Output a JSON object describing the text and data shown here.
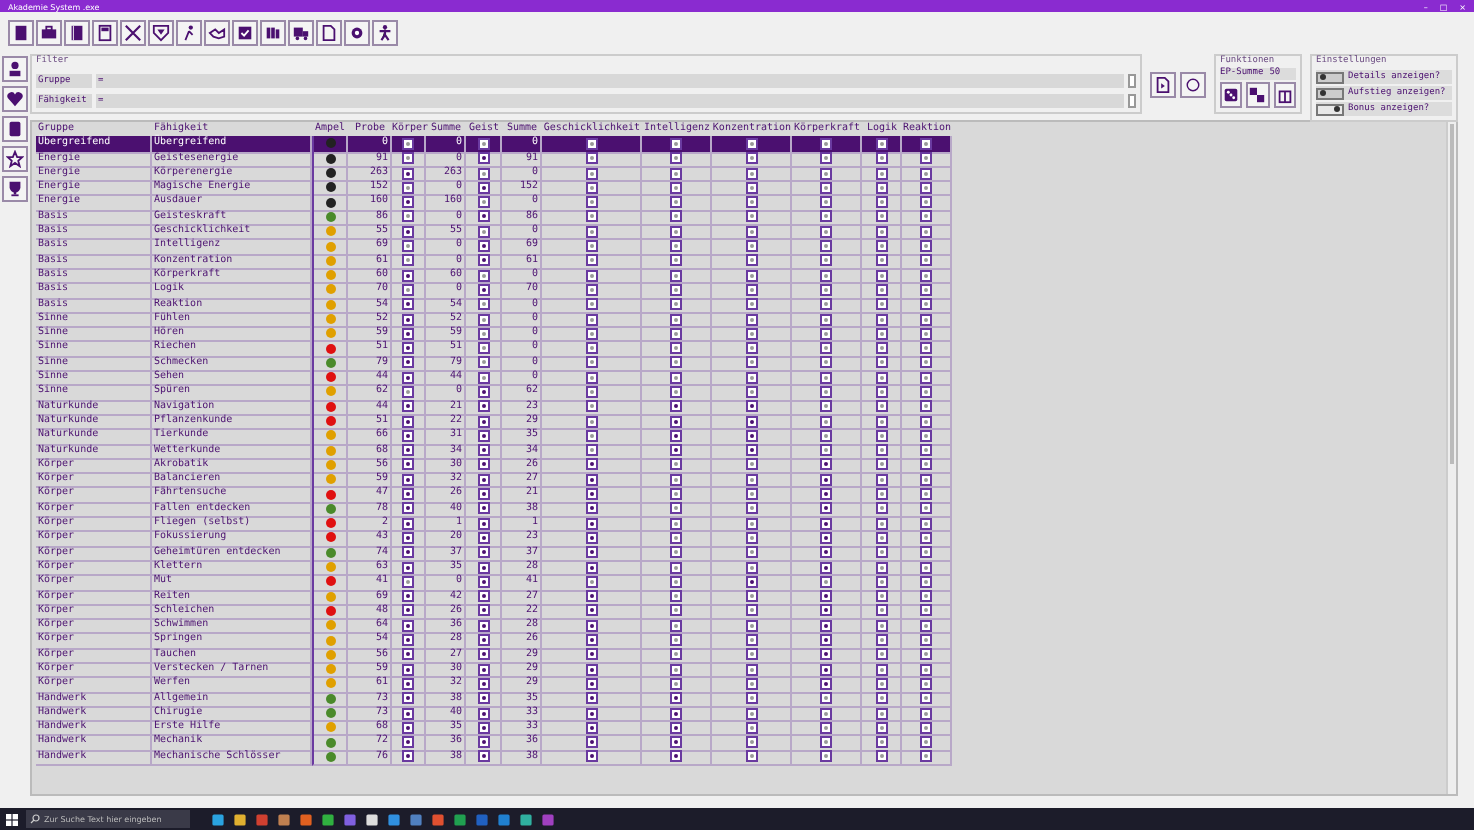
{
  "window": {
    "title": "Akademie System .exe",
    "controls": [
      "–",
      "□",
      "×"
    ]
  },
  "filter": {
    "title": "Filter",
    "fields": [
      {
        "label": "Gruppe",
        "value": "="
      },
      {
        "label": "Fähigkeit",
        "value": "="
      }
    ]
  },
  "functions": {
    "title": "Funktionen",
    "ep_label": "EP-Summe",
    "ep_value": "50"
  },
  "settings": {
    "title": "Einstellungen",
    "toggles": [
      {
        "label": "Details anzeigen?",
        "on": false
      },
      {
        "label": "Aufstieg anzeigen?",
        "on": false
      },
      {
        "label": "Bonus anzeigen?",
        "on": true
      }
    ]
  },
  "table": {
    "columns": [
      "Gruppe",
      "Fähigkeit",
      "Ampel",
      "Probe",
      "Körper",
      "Summe",
      "Geist",
      "Summe",
      "Geschicklichkeit",
      "Intelligenz",
      "Konzentration",
      "Körperkraft",
      "Logik",
      "Reaktion"
    ],
    "rows": [
      {
        "group": "Übergreifend",
        "skill": "Übergreifend",
        "color": "#222222",
        "probe": "0",
        "koerper": {
          "checked": false,
          "sum": "0"
        },
        "geist": {
          "checked": false,
          "sum": "0"
        },
        "attributes": [
          false,
          false,
          false,
          false,
          false,
          false
        ],
        "selected": true
      },
      {
        "group": "Energie",
        "skill": "Geistesenergie",
        "color": "#222222",
        "probe": "91",
        "koerper": {
          "checked": false,
          "sum": "0"
        },
        "geist": {
          "checked": true,
          "sum": "91"
        },
        "attributes": [
          false,
          false,
          false,
          false,
          false,
          false
        ],
        "selected": false
      },
      {
        "group": "Energie",
        "skill": "Körperenergie",
        "color": "#222222",
        "probe": "263",
        "koerper": {
          "checked": true,
          "sum": "263"
        },
        "geist": {
          "checked": false,
          "sum": "0"
        },
        "attributes": [
          false,
          false,
          false,
          false,
          false,
          false
        ],
        "selected": false
      },
      {
        "group": "Energie",
        "skill": "Magische Energie",
        "color": "#222222",
        "probe": "152",
        "koerper": {
          "checked": false,
          "sum": "0"
        },
        "geist": {
          "checked": true,
          "sum": "152"
        },
        "attributes": [
          false,
          false,
          false,
          false,
          false,
          false
        ],
        "selected": false
      },
      {
        "group": "Energie",
        "skill": "Ausdauer",
        "color": "#222222",
        "probe": "160",
        "koerper": {
          "checked": true,
          "sum": "160"
        },
        "geist": {
          "checked": false,
          "sum": "0"
        },
        "attributes": [
          false,
          false,
          false,
          false,
          false,
          false
        ],
        "selected": false
      },
      {
        "group": "Basis",
        "skill": "Geisteskraft",
        "color": "#4a8a2a",
        "probe": "86",
        "koerper": {
          "checked": false,
          "sum": "0"
        },
        "geist": {
          "checked": true,
          "sum": "86"
        },
        "attributes": [
          false,
          false,
          false,
          false,
          false,
          false
        ],
        "selected": false
      },
      {
        "group": "Basis",
        "skill": "Geschicklichkeit",
        "color": "#e0a000",
        "probe": "55",
        "koerper": {
          "checked": true,
          "sum": "55"
        },
        "geist": {
          "checked": false,
          "sum": "0"
        },
        "attributes": [
          false,
          false,
          false,
          false,
          false,
          false
        ],
        "selected": false
      },
      {
        "group": "Basis",
        "skill": "Intelligenz",
        "color": "#e0a000",
        "probe": "69",
        "koerper": {
          "checked": false,
          "sum": "0"
        },
        "geist": {
          "checked": true,
          "sum": "69"
        },
        "attributes": [
          false,
          false,
          false,
          false,
          false,
          false
        ],
        "selected": false
      },
      {
        "group": "Basis",
        "skill": "Konzentration",
        "color": "#e0a000",
        "probe": "61",
        "koerper": {
          "checked": false,
          "sum": "0"
        },
        "geist": {
          "checked": true,
          "sum": "61"
        },
        "attributes": [
          false,
          false,
          false,
          false,
          false,
          false
        ],
        "selected": false
      },
      {
        "group": "Basis",
        "skill": "Körperkraft",
        "color": "#e0a000",
        "probe": "60",
        "koerper": {
          "checked": true,
          "sum": "60"
        },
        "geist": {
          "checked": false,
          "sum": "0"
        },
        "attributes": [
          false,
          false,
          false,
          false,
          false,
          false
        ],
        "selected": false
      },
      {
        "group": "Basis",
        "skill": "Logik",
        "color": "#e0a000",
        "probe": "70",
        "koerper": {
          "checked": false,
          "sum": "0"
        },
        "geist": {
          "checked": true,
          "sum": "70"
        },
        "attributes": [
          false,
          false,
          false,
          false,
          false,
          false
        ],
        "selected": false
      },
      {
        "group": "Basis",
        "skill": "Reaktion",
        "color": "#e0a000",
        "probe": "54",
        "koerper": {
          "checked": true,
          "sum": "54"
        },
        "geist": {
          "checked": false,
          "sum": "0"
        },
        "attributes": [
          false,
          false,
          false,
          false,
          false,
          false
        ],
        "selected": false
      },
      {
        "group": "Sinne",
        "skill": "Fühlen",
        "color": "#e0a000",
        "probe": "52",
        "koerper": {
          "checked": true,
          "sum": "52"
        },
        "geist": {
          "checked": false,
          "sum": "0"
        },
        "attributes": [
          false,
          false,
          false,
          false,
          false,
          false
        ],
        "selected": false
      },
      {
        "group": "Sinne",
        "skill": "Hören",
        "color": "#e0a000",
        "probe": "59",
        "koerper": {
          "checked": true,
          "sum": "59"
        },
        "geist": {
          "checked": false,
          "sum": "0"
        },
        "attributes": [
          false,
          false,
          false,
          false,
          false,
          false
        ],
        "selected": false
      },
      {
        "group": "Sinne",
        "skill": "Riechen",
        "color": "#e01010",
        "probe": "51",
        "koerper": {
          "checked": true,
          "sum": "51"
        },
        "geist": {
          "checked": false,
          "sum": "0"
        },
        "attributes": [
          false,
          false,
          false,
          false,
          false,
          false
        ],
        "selected": false
      },
      {
        "group": "Sinne",
        "skill": "Schmecken",
        "color": "#4a8a2a",
        "probe": "79",
        "koerper": {
          "checked": true,
          "sum": "79"
        },
        "geist": {
          "checked": false,
          "sum": "0"
        },
        "attributes": [
          false,
          false,
          false,
          false,
          false,
          false
        ],
        "selected": false
      },
      {
        "group": "Sinne",
        "skill": "Sehen",
        "color": "#e01010",
        "probe": "44",
        "koerper": {
          "checked": true,
          "sum": "44"
        },
        "geist": {
          "checked": false,
          "sum": "0"
        },
        "attributes": [
          false,
          false,
          false,
          false,
          false,
          false
        ],
        "selected": false
      },
      {
        "group": "Sinne",
        "skill": "Spüren",
        "color": "#e0a000",
        "probe": "62",
        "koerper": {
          "checked": false,
          "sum": "0"
        },
        "geist": {
          "checked": true,
          "sum": "62"
        },
        "attributes": [
          false,
          false,
          false,
          false,
          false,
          false
        ],
        "selected": false
      },
      {
        "group": "Naturkunde",
        "skill": "Navigation",
        "color": "#e01010",
        "probe": "44",
        "koerper": {
          "checked": true,
          "sum": "21"
        },
        "geist": {
          "checked": true,
          "sum": "23"
        },
        "attributes": [
          false,
          true,
          true,
          false,
          false,
          false
        ],
        "selected": false
      },
      {
        "group": "Naturkunde",
        "skill": "Pflanzenkunde",
        "color": "#e01010",
        "probe": "51",
        "koerper": {
          "checked": true,
          "sum": "22"
        },
        "geist": {
          "checked": true,
          "sum": "29"
        },
        "attributes": [
          false,
          true,
          true,
          false,
          false,
          false
        ],
        "selected": false
      },
      {
        "group": "Naturkunde",
        "skill": "Tierkunde",
        "color": "#e0a000",
        "probe": "66",
        "koerper": {
          "checked": true,
          "sum": "31"
        },
        "geist": {
          "checked": true,
          "sum": "35"
        },
        "attributes": [
          false,
          true,
          true,
          false,
          false,
          false
        ],
        "selected": false
      },
      {
        "group": "Naturkunde",
        "skill": "Wetterkunde",
        "color": "#e0a000",
        "probe": "68",
        "koerper": {
          "checked": true,
          "sum": "34"
        },
        "geist": {
          "checked": true,
          "sum": "34"
        },
        "attributes": [
          false,
          true,
          true,
          false,
          false,
          false
        ],
        "selected": false
      },
      {
        "group": "Körper",
        "skill": "Akrobatik",
        "color": "#e0a000",
        "probe": "56",
        "koerper": {
          "checked": true,
          "sum": "30"
        },
        "geist": {
          "checked": true,
          "sum": "26"
        },
        "attributes": [
          true,
          false,
          false,
          true,
          false,
          false
        ],
        "selected": false
      },
      {
        "group": "Körper",
        "skill": "Balancieren",
        "color": "#e0a000",
        "probe": "59",
        "koerper": {
          "checked": true,
          "sum": "32"
        },
        "geist": {
          "checked": true,
          "sum": "27"
        },
        "attributes": [
          true,
          false,
          false,
          true,
          false,
          false
        ],
        "selected": false
      },
      {
        "group": "Körper",
        "skill": "Fährtensuche",
        "color": "#e01010",
        "probe": "47",
        "koerper": {
          "checked": true,
          "sum": "26"
        },
        "geist": {
          "checked": true,
          "sum": "21"
        },
        "attributes": [
          true,
          false,
          false,
          true,
          false,
          false
        ],
        "selected": false
      },
      {
        "group": "Körper",
        "skill": "Fallen entdecken",
        "color": "#4a8a2a",
        "probe": "78",
        "koerper": {
          "checked": true,
          "sum": "40"
        },
        "geist": {
          "checked": true,
          "sum": "38"
        },
        "attributes": [
          true,
          false,
          false,
          true,
          false,
          false
        ],
        "selected": false
      },
      {
        "group": "Körper",
        "skill": "Fliegen (selbst)",
        "color": "#e01010",
        "probe": "2",
        "koerper": {
          "checked": true,
          "sum": "1"
        },
        "geist": {
          "checked": true,
          "sum": "1"
        },
        "attributes": [
          true,
          false,
          false,
          true,
          false,
          false
        ],
        "selected": false
      },
      {
        "group": "Körper",
        "skill": "Fokussierung",
        "color": "#e01010",
        "probe": "43",
        "koerper": {
          "checked": true,
          "sum": "20"
        },
        "geist": {
          "checked": true,
          "sum": "23"
        },
        "attributes": [
          true,
          false,
          false,
          true,
          false,
          false
        ],
        "selected": false
      },
      {
        "group": "Körper",
        "skill": "Geheimtüren entdecken",
        "color": "#4a8a2a",
        "probe": "74",
        "koerper": {
          "checked": true,
          "sum": "37"
        },
        "geist": {
          "checked": true,
          "sum": "37"
        },
        "attributes": [
          true,
          false,
          false,
          true,
          false,
          false
        ],
        "selected": false
      },
      {
        "group": "Körper",
        "skill": "Klettern",
        "color": "#e0a000",
        "probe": "63",
        "koerper": {
          "checked": true,
          "sum": "35"
        },
        "geist": {
          "checked": true,
          "sum": "28"
        },
        "attributes": [
          true,
          false,
          false,
          true,
          false,
          false
        ],
        "selected": false
      },
      {
        "group": "Körper",
        "skill": "Mut",
        "color": "#e01010",
        "probe": "41",
        "koerper": {
          "checked": false,
          "sum": "0"
        },
        "geist": {
          "checked": true,
          "sum": "41"
        },
        "attributes": [
          false,
          false,
          true,
          false,
          false,
          false
        ],
        "selected": false
      },
      {
        "group": "Körper",
        "skill": "Reiten",
        "color": "#e0a000",
        "probe": "69",
        "koerper": {
          "checked": true,
          "sum": "42"
        },
        "geist": {
          "checked": true,
          "sum": "27"
        },
        "attributes": [
          true,
          false,
          false,
          true,
          false,
          false
        ],
        "selected": false
      },
      {
        "group": "Körper",
        "skill": "Schleichen",
        "color": "#e01010",
        "probe": "48",
        "koerper": {
          "checked": true,
          "sum": "26"
        },
        "geist": {
          "checked": true,
          "sum": "22"
        },
        "attributes": [
          true,
          false,
          false,
          true,
          false,
          false
        ],
        "selected": false
      },
      {
        "group": "Körper",
        "skill": "Schwimmen",
        "color": "#e0a000",
        "probe": "64",
        "koerper": {
          "checked": true,
          "sum": "36"
        },
        "geist": {
          "checked": true,
          "sum": "28"
        },
        "attributes": [
          true,
          false,
          false,
          true,
          false,
          false
        ],
        "selected": false
      },
      {
        "group": "Körper",
        "skill": "Springen",
        "color": "#e0a000",
        "probe": "54",
        "koerper": {
          "checked": true,
          "sum": "28"
        },
        "geist": {
          "checked": true,
          "sum": "26"
        },
        "attributes": [
          true,
          false,
          false,
          true,
          false,
          false
        ],
        "selected": false
      },
      {
        "group": "Körper",
        "skill": "Tauchen",
        "color": "#e0a000",
        "probe": "56",
        "koerper": {
          "checked": true,
          "sum": "27"
        },
        "geist": {
          "checked": true,
          "sum": "29"
        },
        "attributes": [
          true,
          false,
          false,
          true,
          false,
          false
        ],
        "selected": false
      },
      {
        "group": "Körper",
        "skill": "Verstecken / Tarnen",
        "color": "#e0a000",
        "probe": "59",
        "koerper": {
          "checked": true,
          "sum": "30"
        },
        "geist": {
          "checked": true,
          "sum": "29"
        },
        "attributes": [
          true,
          false,
          false,
          true,
          false,
          false
        ],
        "selected": false
      },
      {
        "group": "Körper",
        "skill": "Werfen",
        "color": "#e0a000",
        "probe": "61",
        "koerper": {
          "checked": true,
          "sum": "32"
        },
        "geist": {
          "checked": true,
          "sum": "29"
        },
        "attributes": [
          true,
          false,
          false,
          true,
          false,
          false
        ],
        "selected": false
      },
      {
        "group": "Handwerk",
        "skill": "Allgemein",
        "color": "#4a8a2a",
        "probe": "73",
        "koerper": {
          "checked": true,
          "sum": "38"
        },
        "geist": {
          "checked": true,
          "sum": "35"
        },
        "attributes": [
          true,
          true,
          false,
          false,
          false,
          false
        ],
        "selected": false
      },
      {
        "group": "Handwerk",
        "skill": "Chirugie",
        "color": "#4a8a2a",
        "probe": "73",
        "koerper": {
          "checked": true,
          "sum": "40"
        },
        "geist": {
          "checked": true,
          "sum": "33"
        },
        "attributes": [
          true,
          true,
          false,
          false,
          false,
          false
        ],
        "selected": false
      },
      {
        "group": "Handwerk",
        "skill": "Erste Hilfe",
        "color": "#e0a000",
        "probe": "68",
        "koerper": {
          "checked": true,
          "sum": "35"
        },
        "geist": {
          "checked": true,
          "sum": "33"
        },
        "attributes": [
          true,
          true,
          false,
          false,
          false,
          false
        ],
        "selected": false
      },
      {
        "group": "Handwerk",
        "skill": "Mechanik",
        "color": "#4a8a2a",
        "probe": "72",
        "koerper": {
          "checked": true,
          "sum": "36"
        },
        "geist": {
          "checked": true,
          "sum": "36"
        },
        "attributes": [
          true,
          true,
          false,
          false,
          false,
          false
        ],
        "selected": false
      },
      {
        "group": "Handwerk",
        "skill": "Mechanische Schlösser",
        "color": "#4a8a2a",
        "probe": "76",
        "koerper": {
          "checked": true,
          "sum": "38"
        },
        "geist": {
          "checked": true,
          "sum": "38"
        },
        "attributes": [
          true,
          true,
          false,
          false,
          false,
          false
        ],
        "selected": false
      }
    ]
  },
  "taskbar": {
    "search_placeholder": "Zur Suche Text hier eingeben"
  }
}
